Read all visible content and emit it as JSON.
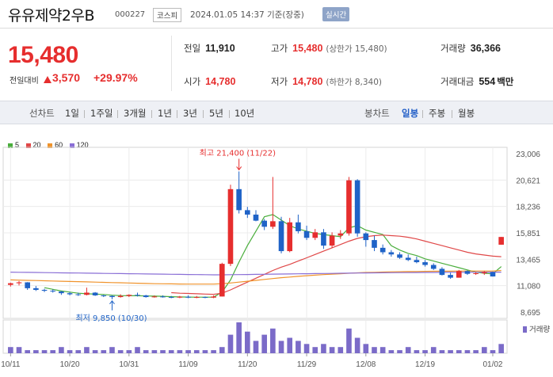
{
  "header": {
    "name": "유유제약2우B",
    "code": "000227",
    "market": "코스피",
    "datetime": "2024.01.05 14:37 기준(장중)",
    "realtime": "실시간"
  },
  "summary": {
    "price": "15,480",
    "change_label": "전일대비",
    "change_amount": "3,570",
    "change_percent": "+29.97%",
    "prev_close_label": "전일",
    "prev_close": "11,910",
    "open_label": "시가",
    "open": "14,780",
    "high_label": "고가",
    "high": "15,480",
    "high_sub": "(상한가 15,480)",
    "low_label": "저가",
    "low": "14,780",
    "low_sub": "(하한가 8,340)",
    "volume_label": "거래량",
    "volume": "36,366",
    "value_label": "거래대금",
    "value": "554",
    "value_unit": "백만"
  },
  "toolbar": {
    "line_chart": "선차트",
    "periods": [
      "1일",
      "1주일",
      "3개월",
      "1년",
      "3년",
      "5년",
      "10년"
    ],
    "candle_chart": "봉차트",
    "candle_periods": [
      "일봉",
      "주봉",
      "월봉"
    ]
  },
  "legend": [
    {
      "label": "5",
      "color": "#4aae3c"
    },
    {
      "label": "20",
      "color": "#e04848"
    },
    {
      "label": "60",
      "color": "#f0932b"
    },
    {
      "label": "120",
      "color": "#8a6fd6"
    }
  ],
  "colors": {
    "up": "#e62e2e",
    "down": "#1f63c7",
    "volume": "#7b6bc8"
  },
  "chart_data": {
    "type": "candlestick",
    "y_ticks": [
      "23,006",
      "20,621",
      "18,236",
      "15,851",
      "13,465",
      "11,080",
      "8,695"
    ],
    "y_tick_values": [
      23006,
      20621,
      18236,
      15851,
      13465,
      11080,
      8695
    ],
    "x_ticks": [
      "10/11",
      "10/20",
      "10/31",
      "11/09",
      "11/20",
      "11/29",
      "12/08",
      "12/19",
      "01/02"
    ],
    "x_tick_index": [
      0,
      7,
      14,
      21,
      28,
      35,
      42,
      49,
      57
    ],
    "volume_label": "거래량",
    "annotation_high": "최고 21,400 (11/22)",
    "annotation_low": "최저 9,850 (10/30)",
    "candles": [
      {
        "o": 11150,
        "h": 11350,
        "l": 11000,
        "c": 11300
      },
      {
        "o": 11300,
        "h": 11500,
        "l": 11100,
        "c": 11380
      },
      {
        "o": 11380,
        "h": 11400,
        "l": 10700,
        "c": 10850
      },
      {
        "o": 10850,
        "h": 11050,
        "l": 10600,
        "c": 10700
      },
      {
        "o": 10700,
        "h": 10800,
        "l": 10500,
        "c": 10620
      },
      {
        "o": 10620,
        "h": 10750,
        "l": 10450,
        "c": 10550
      },
      {
        "o": 10550,
        "h": 10600,
        "l": 10250,
        "c": 10400
      },
      {
        "o": 10400,
        "h": 10500,
        "l": 10200,
        "c": 10300
      },
      {
        "o": 10300,
        "h": 10450,
        "l": 10150,
        "c": 10250
      },
      {
        "o": 10250,
        "h": 10900,
        "l": 10200,
        "c": 10450
      },
      {
        "o": 10450,
        "h": 10500,
        "l": 10150,
        "c": 10200
      },
      {
        "o": 10200,
        "h": 10250,
        "l": 10050,
        "c": 10150
      },
      {
        "o": 10150,
        "h": 10200,
        "l": 9850,
        "c": 10050
      },
      {
        "o": 10050,
        "h": 10300,
        "l": 10000,
        "c": 10150
      },
      {
        "o": 10150,
        "h": 10300,
        "l": 10050,
        "c": 10250
      },
      {
        "o": 10250,
        "h": 10450,
        "l": 10100,
        "c": 10200
      },
      {
        "o": 10200,
        "h": 10250,
        "l": 10000,
        "c": 10050
      },
      {
        "o": 10050,
        "h": 10200,
        "l": 10000,
        "c": 10100
      },
      {
        "o": 10100,
        "h": 10200,
        "l": 10000,
        "c": 10050
      },
      {
        "o": 10050,
        "h": 10150,
        "l": 9950,
        "c": 10000
      },
      {
        "o": 10000,
        "h": 10150,
        "l": 9950,
        "c": 10080
      },
      {
        "o": 10080,
        "h": 10200,
        "l": 9950,
        "c": 10000
      },
      {
        "o": 10000,
        "h": 10150,
        "l": 9950,
        "c": 10050
      },
      {
        "o": 10050,
        "h": 10100,
        "l": 9950,
        "c": 10000
      },
      {
        "o": 10000,
        "h": 10200,
        "l": 9950,
        "c": 10100
      },
      {
        "o": 10100,
        "h": 13150,
        "l": 10100,
        "c": 13050
      },
      {
        "o": 13050,
        "h": 20200,
        "l": 12850,
        "c": 19800
      },
      {
        "o": 19800,
        "h": 21400,
        "l": 17600,
        "c": 17900
      },
      {
        "o": 17900,
        "h": 18200,
        "l": 17200,
        "c": 17500
      },
      {
        "o": 17500,
        "h": 17900,
        "l": 16900,
        "c": 16950
      },
      {
        "o": 16950,
        "h": 17100,
        "l": 16100,
        "c": 16400
      },
      {
        "o": 16400,
        "h": 20900,
        "l": 16200,
        "c": 16900
      },
      {
        "o": 16900,
        "h": 17300,
        "l": 14000,
        "c": 14200
      },
      {
        "o": 14200,
        "h": 17200,
        "l": 14100,
        "c": 16800
      },
      {
        "o": 16800,
        "h": 17500,
        "l": 15800,
        "c": 16000
      },
      {
        "o": 16000,
        "h": 16500,
        "l": 15200,
        "c": 15400
      },
      {
        "o": 15400,
        "h": 16200,
        "l": 15200,
        "c": 15900
      },
      {
        "o": 15900,
        "h": 16200,
        "l": 14400,
        "c": 14700
      },
      {
        "o": 14700,
        "h": 15900,
        "l": 14500,
        "c": 15600
      },
      {
        "o": 15600,
        "h": 16100,
        "l": 15300,
        "c": 15800
      },
      {
        "o": 15800,
        "h": 20900,
        "l": 15600,
        "c": 20600
      },
      {
        "o": 20600,
        "h": 20700,
        "l": 15500,
        "c": 15800
      },
      {
        "o": 15800,
        "h": 15900,
        "l": 14600,
        "c": 15200
      },
      {
        "o": 15200,
        "h": 15600,
        "l": 14200,
        "c": 14500
      },
      {
        "o": 14500,
        "h": 14800,
        "l": 13900,
        "c": 14100
      },
      {
        "o": 14100,
        "h": 14300,
        "l": 13700,
        "c": 13900
      },
      {
        "o": 13900,
        "h": 14100,
        "l": 13500,
        "c": 13600
      },
      {
        "o": 13600,
        "h": 13900,
        "l": 13300,
        "c": 13400
      },
      {
        "o": 13400,
        "h": 13700,
        "l": 13100,
        "c": 13200
      },
      {
        "o": 13200,
        "h": 13400,
        "l": 12800,
        "c": 12950
      },
      {
        "o": 12950,
        "h": 13100,
        "l": 12500,
        "c": 12600
      },
      {
        "o": 12600,
        "h": 12750,
        "l": 12000,
        "c": 12050
      },
      {
        "o": 12050,
        "h": 12250,
        "l": 11700,
        "c": 11800
      },
      {
        "o": 11800,
        "h": 12500,
        "l": 11800,
        "c": 12400
      },
      {
        "o": 12400,
        "h": 12450,
        "l": 12050,
        "c": 12150
      },
      {
        "o": 12150,
        "h": 12300,
        "l": 12050,
        "c": 12200
      },
      {
        "o": 12200,
        "h": 12400,
        "l": 12050,
        "c": 12300
      },
      {
        "o": 12300,
        "h": 12350,
        "l": 11900,
        "c": 11910
      },
      {
        "o": 14780,
        "h": 15480,
        "l": 14780,
        "c": 15480
      }
    ],
    "volume": [
      2,
      2,
      1,
      1,
      1,
      1,
      2,
      1,
      1,
      2,
      1,
      1,
      2,
      1,
      1,
      2,
      1,
      1,
      1,
      1,
      1,
      1,
      1,
      1,
      1,
      2,
      6,
      10,
      7,
      4,
      6,
      8,
      4,
      5,
      4,
      3,
      2,
      3,
      2,
      2,
      8,
      5,
      3,
      2,
      2,
      1,
      1,
      2,
      1,
      1,
      2,
      1,
      1,
      1,
      1,
      1,
      2,
      1,
      3
    ],
    "ma": {
      "5": [
        null,
        null,
        null,
        null,
        10900,
        10750,
        10600,
        10500,
        10400,
        10350,
        10320,
        10280,
        10220,
        10180,
        10170,
        10170,
        10150,
        10130,
        10120,
        10080,
        10060,
        10050,
        10040,
        10040,
        10050,
        10500,
        11600,
        13200,
        14700,
        16000,
        17300,
        17500,
        17000,
        16500,
        16200,
        16000,
        15800,
        15700,
        15600,
        15500,
        16300,
        16500,
        16100,
        15900,
        15700,
        14700,
        14300,
        14000,
        13800,
        13500,
        13300,
        13100,
        12900,
        12700,
        12500,
        12300,
        12200,
        12150,
        12800
      ],
      "20": [
        null,
        null,
        null,
        null,
        null,
        null,
        null,
        null,
        null,
        null,
        null,
        null,
        null,
        null,
        null,
        null,
        null,
        null,
        null,
        10450,
        10400,
        10380,
        10350,
        10320,
        10300,
        10400,
        10700,
        11050,
        11400,
        11750,
        12100,
        12450,
        12750,
        13000,
        13300,
        13600,
        13900,
        14200,
        14500,
        14800,
        15100,
        15350,
        15500,
        15600,
        15650,
        15600,
        15550,
        15450,
        15300,
        15100,
        14900,
        14700,
        14500,
        14300,
        14100,
        13950,
        13850,
        13750,
        13700
      ],
      "60": [
        11600,
        11580,
        11560,
        11540,
        11520,
        11500,
        11480,
        11460,
        11440,
        11420,
        11400,
        11380,
        11360,
        11340,
        11320,
        11300,
        11280,
        11260,
        11250,
        11240,
        11230,
        11220,
        11220,
        11220,
        11220,
        11260,
        11320,
        11400,
        11480,
        11560,
        11640,
        11720,
        11800,
        11860,
        11920,
        11980,
        12030,
        12080,
        12120,
        12160,
        12200,
        12240,
        12270,
        12290,
        12310,
        12330,
        12340,
        12350,
        12360,
        12370,
        12380,
        12390,
        12390,
        12400,
        12400,
        12400,
        12400,
        12400,
        12450
      ],
      "120": [
        12300,
        12290,
        12280,
        12270,
        12260,
        12250,
        12240,
        12230,
        12220,
        12210,
        12200,
        12190,
        12180,
        12170,
        12160,
        12150,
        12140,
        12130,
        12120,
        12110,
        12100,
        12090,
        12080,
        12070,
        12060,
        12060,
        12070,
        12080,
        12090,
        12100,
        12110,
        12120,
        12130,
        12140,
        12150,
        12160,
        12170,
        12180,
        12190,
        12200,
        12210,
        12220,
        12230,
        12240,
        12245,
        12250,
        12255,
        12260,
        12265,
        12270,
        12275,
        12280,
        12285,
        12290,
        12290,
        12295,
        12300,
        12300,
        12300
      ]
    }
  }
}
